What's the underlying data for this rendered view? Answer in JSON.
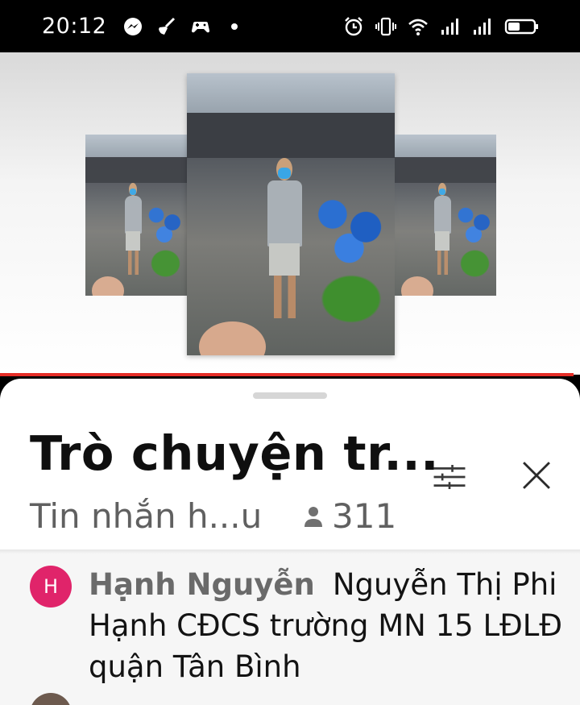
{
  "status_bar": {
    "time": "20:12",
    "left_icons": [
      "messenger-icon",
      "broom-icon",
      "gamepad-icon",
      "dot-icon"
    ],
    "right_icons": [
      "alarm-icon",
      "vibrate-icon",
      "wifi-icon",
      "signal-icon",
      "signal-icon",
      "battery-icon"
    ]
  },
  "video": {
    "progress_color": "#e52d27"
  },
  "chat": {
    "title": "Trò chuyện tr...",
    "subtitle": "Tin nhắn h...u",
    "viewer_count": "311",
    "messages": [
      {
        "avatar_letter": "H",
        "avatar_color": "#e0246a",
        "author": "Hạnh Nguyễn",
        "text": "Nguyễn Thị Phi Hạnh CĐCS trường MN 15 LĐLĐ quận Tân Bình"
      }
    ]
  }
}
